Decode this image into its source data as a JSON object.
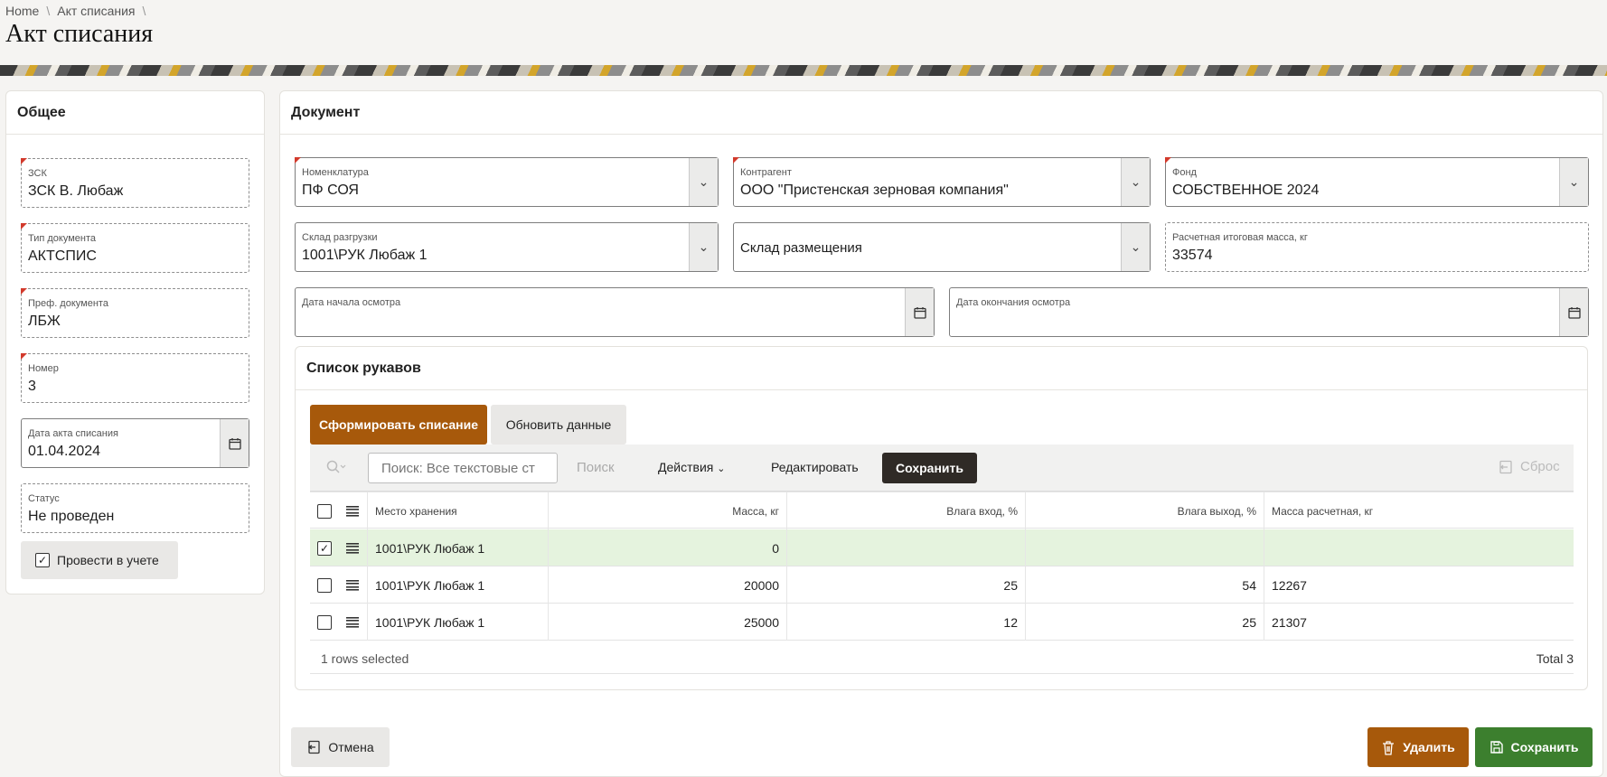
{
  "breadcrumb": {
    "home": "Home",
    "current": "Акт списания"
  },
  "page": {
    "title": "Акт списания"
  },
  "general": {
    "title": "Общее",
    "zsk": {
      "label": "ЗСК",
      "value": "ЗСК В. Любаж"
    },
    "doc_type": {
      "label": "Тип документа",
      "value": "АКТСПИС"
    },
    "doc_prefix": {
      "label": "Преф. документа",
      "value": "ЛБЖ"
    },
    "number": {
      "label": "Номер",
      "value": "3"
    },
    "act_date": {
      "label": "Дата акта списания",
      "value": "01.04.2024"
    },
    "status": {
      "label": "Статус",
      "value": "Не проведен"
    },
    "post_button": "Провести в учете",
    "post_checked": true
  },
  "document": {
    "title": "Документ",
    "nomenclature": {
      "label": "Номенклатура",
      "value": "ПФ СОЯ"
    },
    "counterparty": {
      "label": "Контрагент",
      "value": "ООО \"Пристенская зерновая компания\""
    },
    "fund": {
      "label": "Фонд",
      "value": "СОБСТВЕННОЕ 2024"
    },
    "unload_warehouse": {
      "label": "Склад разгрузки",
      "value": "1001\\РУК Любаж 1"
    },
    "placement_warehouse": {
      "label": "Склад размещения",
      "value": ""
    },
    "calc_mass": {
      "label": "Расчетная итоговая масса, кг",
      "value": "33574"
    },
    "inspection_start": {
      "label": "Дата начала осмотра",
      "value": ""
    },
    "inspection_end": {
      "label": "Дата окончания осмотра",
      "value": ""
    }
  },
  "sleeves": {
    "title": "Список рукавов",
    "form_button": "Сформировать списание",
    "refresh_button": "Обновить данные",
    "search_placeholder": "Поиск: Все текстовые ст",
    "search_button": "Поиск",
    "actions_menu": "Действия",
    "edit_button": "Редактировать",
    "save_button": "Сохранить",
    "reset_button": "Сброс",
    "columns": [
      "Место хранения",
      "Масса, кг",
      "Влага вход, %",
      "Влага выход, %",
      "Масса расчетная, кг"
    ],
    "rows": [
      {
        "checked": true,
        "cells": [
          "1001\\РУК Любаж 1",
          "0",
          "",
          "",
          ""
        ]
      },
      {
        "checked": false,
        "cells": [
          "1001\\РУК Любаж 1",
          "20000",
          "25",
          "54",
          "12267"
        ]
      },
      {
        "checked": false,
        "cells": [
          "1001\\РУК Любаж 1",
          "25000",
          "12",
          "25",
          "21307"
        ]
      }
    ],
    "footer_selected": "1 rows selected",
    "footer_total": "Total 3"
  },
  "footer": {
    "cancel_button": "Отмена",
    "delete_button": "Удалить",
    "save_button": "Сохранить"
  },
  "colors": {
    "accent_brown": "#a7590b",
    "dark": "#2f2a26",
    "green": "#3c7f2e",
    "selected_row": "#e5f3de",
    "required_marker": "#d23a2c"
  }
}
